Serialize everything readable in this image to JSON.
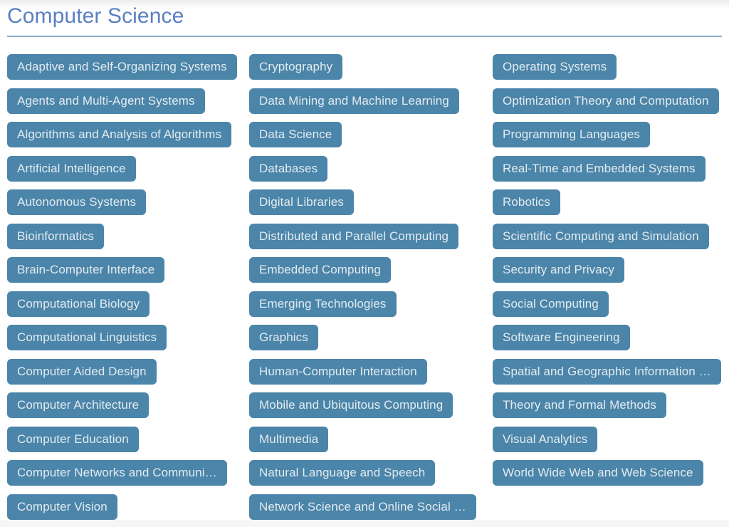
{
  "page": {
    "title": "Computer Science",
    "title_color": "#5a7fc2",
    "rule_color": "#8fadcd",
    "background_color": "#ffffff",
    "chip_color": "#4b85a9",
    "chip_text_color": "#e3ebf0"
  },
  "columns": [
    {
      "id": "column-1",
      "chips": [
        {
          "label": "Adaptive and Self-Organizing Systems",
          "truncated": false
        },
        {
          "label": "Agents and Multi-Agent Systems",
          "truncated": false
        },
        {
          "label": "Algorithms and Analysis of Algorithms",
          "truncated": false
        },
        {
          "label": "Artificial Intelligence",
          "truncated": false
        },
        {
          "label": "Autonomous Systems",
          "truncated": false
        },
        {
          "label": "Bioinformatics",
          "truncated": false
        },
        {
          "label": "Brain-Computer Interface",
          "truncated": false
        },
        {
          "label": "Computational Biology",
          "truncated": false
        },
        {
          "label": "Computational Linguistics",
          "truncated": false
        },
        {
          "label": "Computer Aided Design",
          "truncated": false
        },
        {
          "label": "Computer Architecture",
          "truncated": false
        },
        {
          "label": "Computer Education",
          "truncated": false
        },
        {
          "label": "Computer Networks and Communi…",
          "truncated": true
        },
        {
          "label": "Computer Vision",
          "truncated": false
        }
      ]
    },
    {
      "id": "column-2",
      "chips": [
        {
          "label": "Cryptography",
          "truncated": false
        },
        {
          "label": "Data Mining and Machine Learning",
          "truncated": false
        },
        {
          "label": "Data Science",
          "truncated": false
        },
        {
          "label": "Databases",
          "truncated": false
        },
        {
          "label": "Digital Libraries",
          "truncated": false
        },
        {
          "label": "Distributed and Parallel Computing",
          "truncated": false
        },
        {
          "label": "Embedded Computing",
          "truncated": false
        },
        {
          "label": "Emerging Technologies",
          "truncated": false
        },
        {
          "label": "Graphics",
          "truncated": false
        },
        {
          "label": "Human-Computer Interaction",
          "truncated": false
        },
        {
          "label": "Mobile and Ubiquitous Computing",
          "truncated": false
        },
        {
          "label": "Multimedia",
          "truncated": false
        },
        {
          "label": "Natural Language and Speech",
          "truncated": false
        },
        {
          "label": "Network Science and Online Social …",
          "truncated": true
        }
      ]
    },
    {
      "id": "column-3",
      "chips": [
        {
          "label": "Operating Systems",
          "truncated": false
        },
        {
          "label": "Optimization Theory and Computation",
          "truncated": true
        },
        {
          "label": "Programming Languages",
          "truncated": false
        },
        {
          "label": "Real-Time and Embedded Systems",
          "truncated": false
        },
        {
          "label": "Robotics",
          "truncated": false
        },
        {
          "label": "Scientific Computing and Simulation",
          "truncated": false
        },
        {
          "label": "Security and Privacy",
          "truncated": false
        },
        {
          "label": "Social Computing",
          "truncated": false
        },
        {
          "label": "Software Engineering",
          "truncated": false
        },
        {
          "label": "Spatial and Geographic Information …",
          "truncated": true
        },
        {
          "label": "Theory and Formal Methods",
          "truncated": false
        },
        {
          "label": "Visual Analytics",
          "truncated": false
        },
        {
          "label": "World Wide Web and Web Science",
          "truncated": false
        }
      ]
    }
  ]
}
